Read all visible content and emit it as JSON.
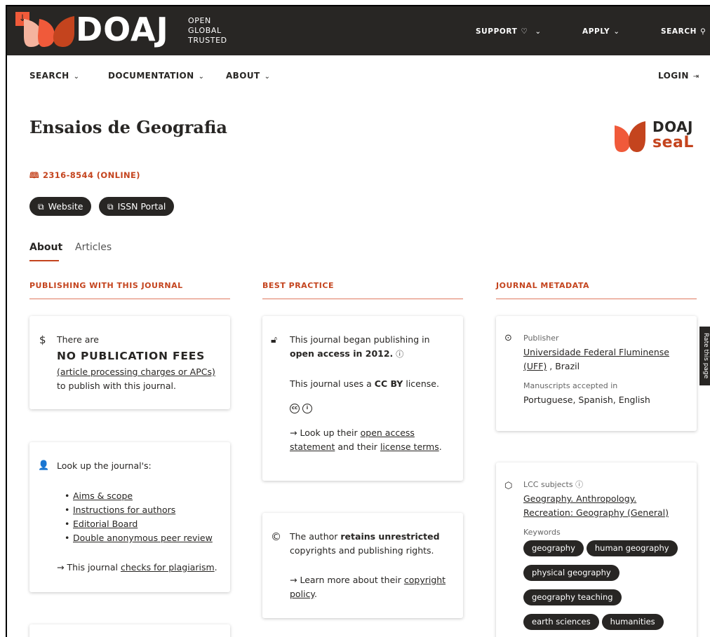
{
  "topbar": {
    "download_icon": "arrow-down-icon",
    "logo_text": "DOAJ",
    "tagline": [
      "OPEN",
      "GLOBAL",
      "TRUSTED"
    ],
    "nav": [
      {
        "label": "SUPPORT",
        "icon": "heart-icon",
        "has_dropdown": true
      },
      {
        "label": "APPLY",
        "has_dropdown": true
      },
      {
        "label": "SEARCH",
        "icon": "search-icon"
      }
    ]
  },
  "subnav": {
    "items": [
      "SEARCH",
      "DOCUMENTATION",
      "ABOUT"
    ],
    "login": "LOGIN"
  },
  "journal": {
    "title": "Ensaios de Geografia",
    "issn": "2316-8544 (ONLINE)",
    "buttons": [
      "Website",
      "ISSN Portal"
    ],
    "seal": {
      "line1": "DOAJ",
      "line2": "seaL"
    }
  },
  "tabs": [
    "About",
    "Articles"
  ],
  "columns": {
    "publishing": "PUBLISHING WITH THIS JOURNAL",
    "best_practice": "BEST PRACTICE",
    "metadata": "JOURNAL METADATA"
  },
  "fees_card": {
    "there_are": "There are",
    "headline": "NO PUBLICATION FEES",
    "link": "(article processing charges or APCs)",
    "tail": "to publish with this journal."
  },
  "lookup_card": {
    "intro": "Look up the journal's:",
    "links": [
      "Aims & scope",
      "Instructions for authors",
      "Editorial Board",
      "Double anonymous peer review"
    ],
    "plag_prefix": "→ This journal ",
    "plag_link": "checks for plagiarism",
    "plag_suffix": "."
  },
  "oa_card": {
    "line1_pre": "This journal began publishing in ",
    "line1_bold": "open access in 2012.",
    "license_pre": "This journal uses a ",
    "license_bold": "CC BY",
    "license_post": " license.",
    "lookup_pre": "→ Look up their ",
    "oa_link": "open access statement",
    "and_their": " and their ",
    "license_link": "license terms",
    "period": "."
  },
  "copyright_card": {
    "pre": "The author ",
    "bold": "retains unrestricted",
    "post": "copyrights and publishing rights.",
    "learn_pre": "→ Learn more about their ",
    "link": "copyright policy",
    "period": "."
  },
  "publisher_card": {
    "publisher_label": "Publisher",
    "publisher_link": "Universidade Federal Fluminense (UFF)",
    "publisher_country": " , Brazil",
    "manuscripts_label": "Manuscripts accepted in",
    "languages": "Portuguese, Spanish, English"
  },
  "subjects_card": {
    "lcc_label": "LCC subjects",
    "lcc_link": "Geography. Anthropology. Recreation: Geography (General)",
    "keywords_label": "Keywords",
    "keywords": [
      "geography",
      "human geography",
      "physical geography",
      "geography teaching",
      "earth sciences",
      "humanities"
    ]
  },
  "side_tab": "Rate this page"
}
